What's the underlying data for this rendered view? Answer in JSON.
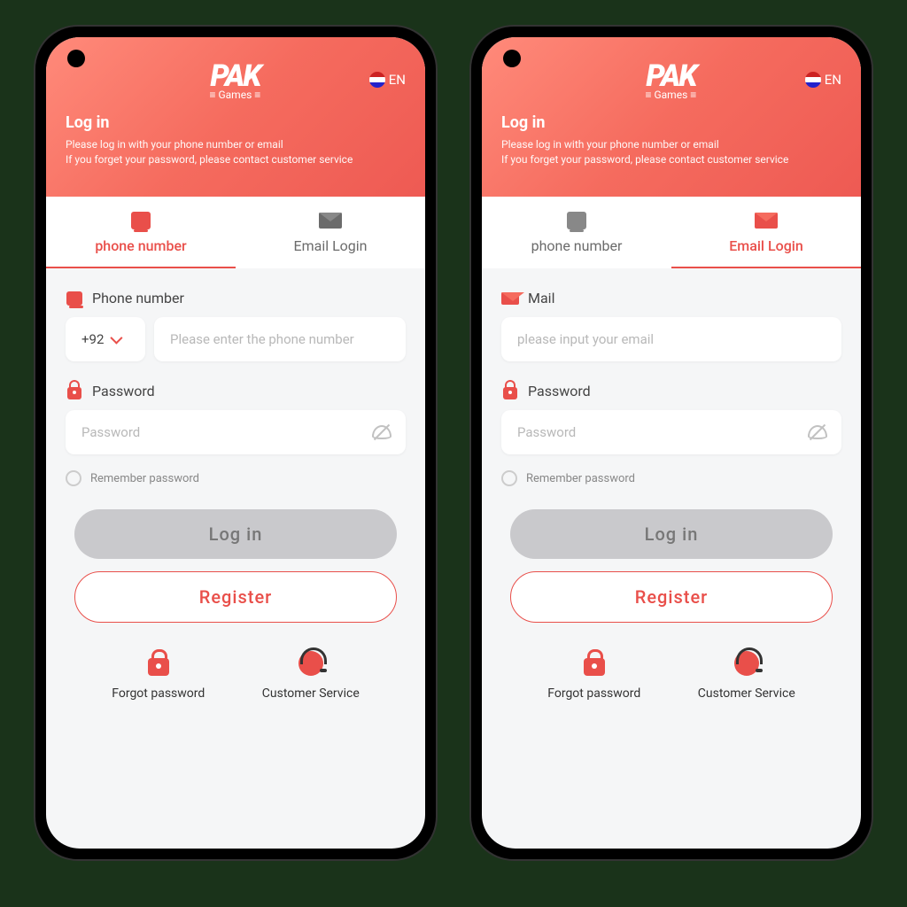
{
  "brand": {
    "name": "PAK",
    "sub": "≡ Games ≡",
    "lang_label": "EN"
  },
  "header": {
    "title": "Log in",
    "line1": "Please log in with your phone number or email",
    "line2": "If you forget your password, please contact customer service"
  },
  "tabs": {
    "phone": "phone number",
    "email": "Email Login"
  },
  "left": {
    "field1_label": "Phone number",
    "country_code": "+92",
    "phone_placeholder": "Please enter the phone number",
    "password_label": "Password",
    "password_placeholder": "Password",
    "remember": "Remember password",
    "login_btn": "Log in",
    "register_btn": "Register"
  },
  "right": {
    "field1_label": "Mail",
    "email_placeholder": "please input your email",
    "password_label": "Password",
    "password_placeholder": "Password",
    "remember": "Remember password",
    "login_btn": "Log in",
    "register_btn": "Register"
  },
  "footer": {
    "forgot": "Forgot password",
    "support": "Customer Service"
  },
  "colors": {
    "accent": "#e94f4a"
  }
}
